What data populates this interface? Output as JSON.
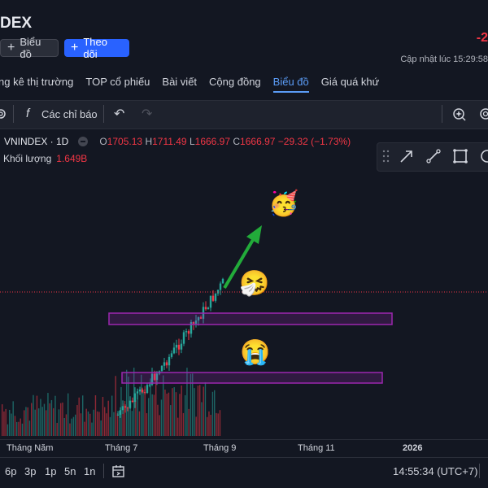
{
  "header": {
    "title": "DEX",
    "chart_button": "Biểu đồ",
    "follow_button": "Theo dõi",
    "price_change": "-2",
    "updated": "Cập nhật lúc  15:29:58"
  },
  "tabs": [
    {
      "label": "ng kê thị trường",
      "active": false
    },
    {
      "label": "TOP cổ phiếu",
      "active": false
    },
    {
      "label": "Bài viết",
      "active": false
    },
    {
      "label": "Cộng đồng",
      "active": false
    },
    {
      "label": "Biểu đồ",
      "active": true
    },
    {
      "label": "Giá quá khứ",
      "active": false
    }
  ],
  "toolbar": {
    "indicators_label": "Các chỉ báo",
    "fx_glyph": "f",
    "undo_glyph": "↶",
    "redo_glyph": "↷"
  },
  "legend": {
    "symbol": "VNINDEX · 1D",
    "o_label": "O",
    "o_value": "1705.13",
    "h_label": "H",
    "h_value": "1711.49",
    "l_label": "L",
    "l_value": "1666.97",
    "c_label": "C",
    "c_value": "1666.97",
    "change": "−29.32 (−1.73%)",
    "volume_label": "Khối lượng",
    "volume_value": "1.649B"
  },
  "x_axis": {
    "ticks": [
      {
        "label": "Tháng Năm",
        "bold": false
      },
      {
        "label": "Tháng 7",
        "bold": false
      },
      {
        "label": "Tháng 9",
        "bold": false
      },
      {
        "label": "Tháng 11",
        "bold": false
      },
      {
        "label": "2026",
        "bold": true
      }
    ]
  },
  "timeframes": [
    "6p",
    "3p",
    "1p",
    "5n",
    "1n"
  ],
  "clock": "14:55:34 (UTC+7)",
  "annotations": {
    "emoji_party": "🥳",
    "emoji_sneeze": "🤧",
    "emoji_cry": "😭"
  },
  "colors": {
    "up": "#26a69a",
    "down": "#f23645",
    "accent": "#2962ff",
    "zone": "#9c27b0",
    "arrow": "#22ab3a"
  }
}
